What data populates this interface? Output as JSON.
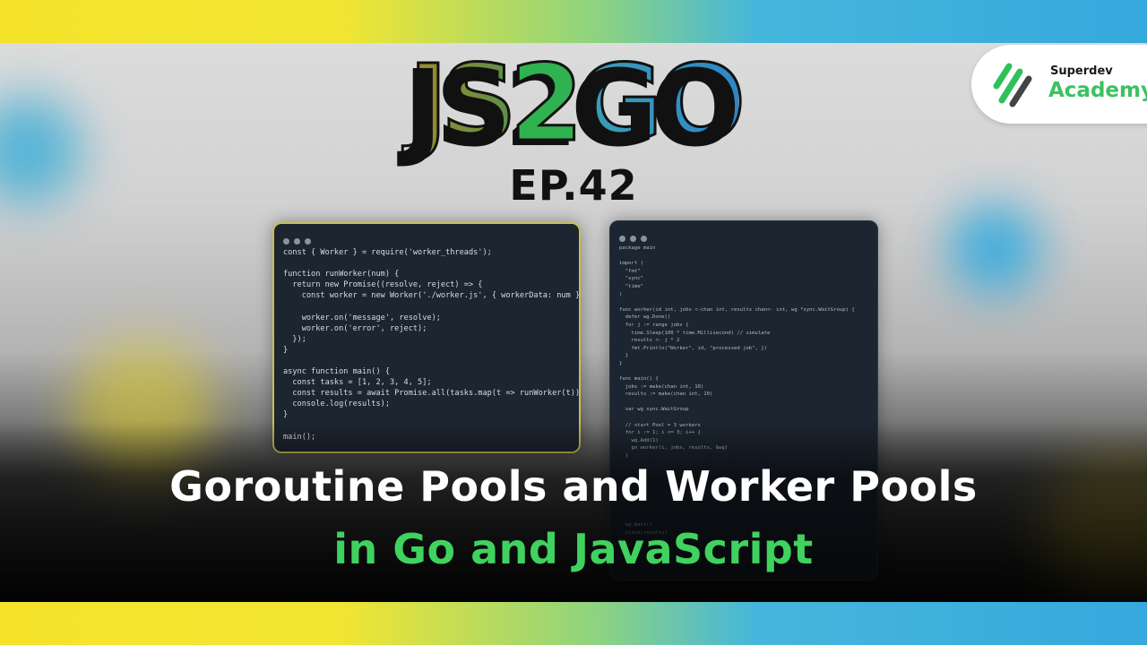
{
  "logo": {
    "part1": "JS",
    "part2": "2",
    "part3": "GO"
  },
  "episode": "EP.42",
  "brand": {
    "small": "Superdev",
    "big": "Academy",
    "icon": "slash-stripes-icon"
  },
  "js_code": [
    "const { Worker } = require('worker_threads');",
    "",
    "function runWorker(num) {",
    "  return new Promise((resolve, reject) => {",
    "    const worker = new Worker('./worker.js', { workerData: num });",
    "",
    "    worker.on('message', resolve);",
    "    worker.on('error', reject);",
    "  });",
    "}",
    "",
    "async function main() {",
    "  const tasks = [1, 2, 3, 4, 5];",
    "  const results = await Promise.all(tasks.map(t => runWorker(t)));",
    "  console.log(results);",
    "}",
    "",
    "main();"
  ],
  "go_code": [
    "package main",
    "",
    "import (",
    "  \"fmt\"",
    "  \"sync\"",
    "  \"time\"",
    ")",
    "",
    "func worker(id int, jobs <-chan int, results chan<- int, wg *sync.WaitGroup) {",
    "  defer wg.Done()",
    "  for j := range jobs {",
    "    time.Sleep(100 * time.Millisecond) // simulate",
    "    results <- j * 2",
    "    fmt.Println(\"Worker\", id, \"processed job\", j)",
    "  }",
    "}",
    "",
    "func main() {",
    "  jobs := make(chan int, 10)",
    "  results := make(chan int, 10)",
    "",
    "  var wg sync.WaitGroup",
    "",
    "  // start Pool = 3 workers",
    "  for i := 1; i <= 3; i++ {",
    "    wg.Add(1)",
    "    go worker(i, jobs, results, &wg)",
    "  }",
    "",
    "",
    "",
    "",
    "",
    "",
    "",
    "",
    "  wg.Wait()",
    "  close(results)",
    "}"
  ],
  "title": {
    "line1": "Goroutine Pools and Worker Pools",
    "line2": "in Go and JavaScript"
  },
  "colors": {
    "accent_green": "#3fd25f",
    "stripe_yellow": "#f5e32a",
    "stripe_blue": "#35a9dd"
  }
}
